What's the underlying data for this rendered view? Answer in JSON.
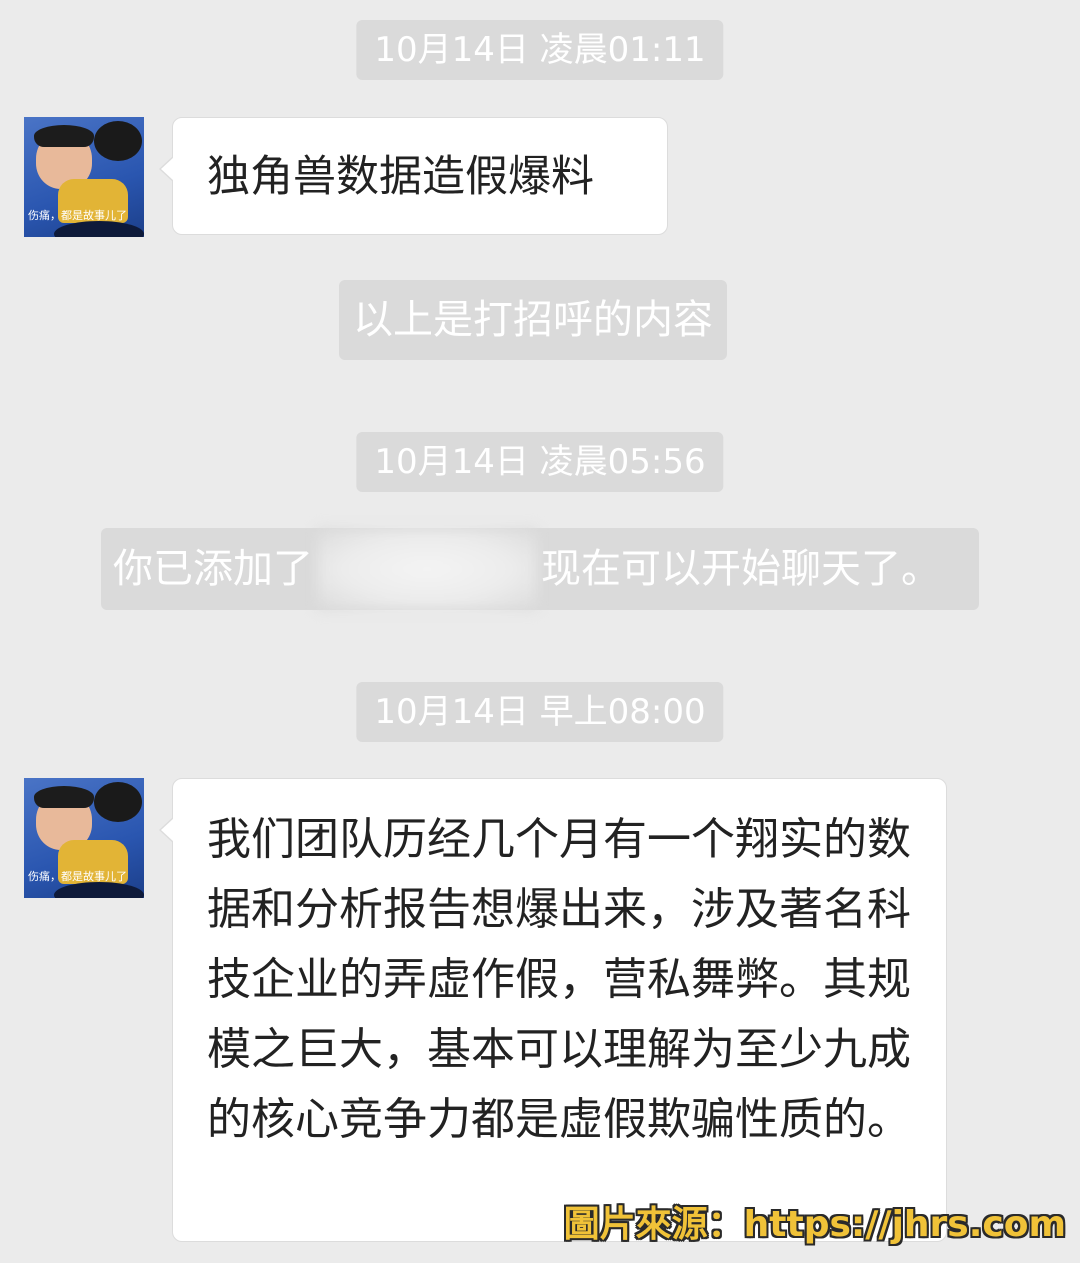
{
  "messages": {
    "time1": "10月14日 凌晨01:11",
    "greeting": "独角兽数据造假爆料",
    "system_greeting_note": "以上是打招呼的内容",
    "time2": "10月14日 凌晨05:56",
    "system_added_prefix": "你已添加了",
    "system_added_suffix": "现在可以开始聊天了。",
    "time3": "10月14日 早上08:00",
    "main_message": "我们团队历经几个月有一个翔实的数据和分析报告想爆出来，涉及著名科技企业的弄虚作假，营私舞弊。其规模之巨大，基本可以理解为至少九成的核心竞争力都是虚假欺骗性质的。"
  },
  "avatar": {
    "caption": "伤痛，都是故事儿了"
  },
  "watermark": "圖片來源：https://jhrs.com",
  "colors": {
    "background": "#ebebeb",
    "system_bubble": "#dadada",
    "message_bubble": "#ffffff",
    "watermark": "#f0c238"
  }
}
